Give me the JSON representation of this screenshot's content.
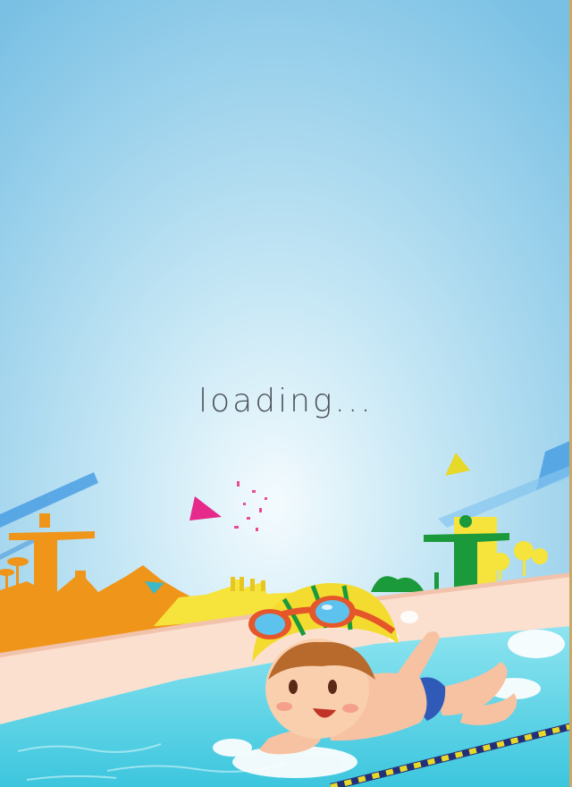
{
  "loading": {
    "text": "loading..."
  },
  "scene": {
    "sky_top_color": "#7ec4e6",
    "sky_bottom_color": "#e9f6fc",
    "pool_color": "#5cd3e8",
    "skyline_color": "#ef951a",
    "brazil_green": "#1a9a3a",
    "brazil_yellow": "#f6e33b",
    "pennant_magenta": "#e52a8c",
    "pennant_yellow": "#e6d92a"
  },
  "character": {
    "cap_color": "#f3dc2f",
    "goggle_color": "#e5562a",
    "trunks_color": "#2f5ab8"
  }
}
